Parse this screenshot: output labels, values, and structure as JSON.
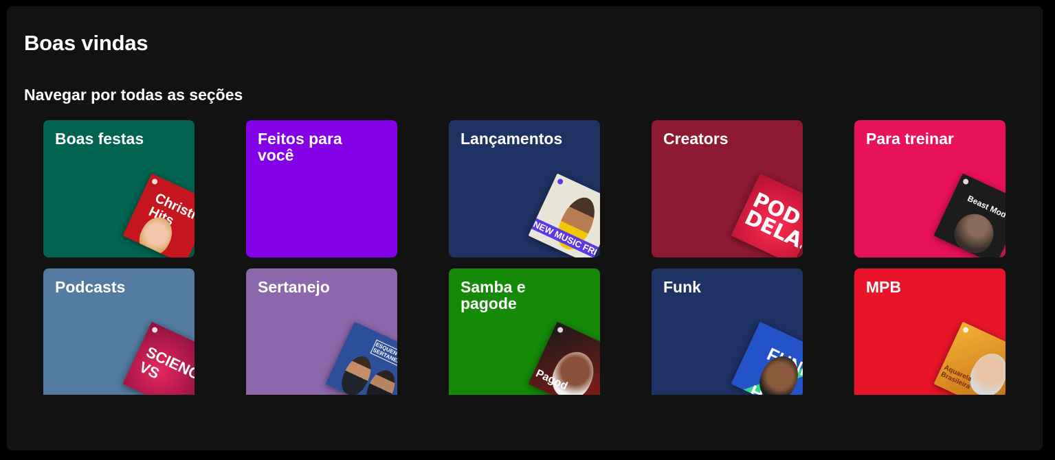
{
  "page": {
    "title": "Boas vindas",
    "section_title": "Navegar por todas as seções"
  },
  "cards": [
    {
      "label": "Boas festas",
      "color": "#006450",
      "cover": {
        "name": "christmas-hits-cover",
        "text": "Christmas Hits",
        "bg": "#c4161c"
      }
    },
    {
      "label": "Feitos para você",
      "color": "#8400e7",
      "cover": null
    },
    {
      "label": "Lançamentos",
      "color": "#1e3264",
      "cover": {
        "name": "new-music-friday-cover",
        "text": "NEW MUSIC FRIDAY",
        "bg": "#e9e4d8"
      }
    },
    {
      "label": "Creators",
      "color": "#8d1932",
      "cover": {
        "name": "pod-delas-cover",
        "text": "POD DELAS",
        "bg": "#d0163a"
      }
    },
    {
      "label": "Para treinar",
      "color": "#e8115b",
      "cover": {
        "name": "beast-mode-cover",
        "text": "Beast Mode",
        "bg": "#1c1c1c"
      }
    },
    {
      "label": "Podcasts",
      "color": "#537aa1",
      "cover": {
        "name": "science-vs-cover",
        "text": "SCIENCE VS",
        "bg": "#c0114b"
      }
    },
    {
      "label": "Sertanejo",
      "color": "#8d67ab",
      "cover": {
        "name": "esquenta-sertanejo-cover",
        "text": "ESQUENTA SERTANEJO",
        "bg": "#2c4f9a"
      }
    },
    {
      "label": "Samba e pagode",
      "color": "#148a08",
      "cover": {
        "name": "pagodeira-cover",
        "text": "Pagod",
        "bg": "#8e1c16"
      }
    },
    {
      "label": "Funk",
      "color": "#1e3264",
      "cover": {
        "name": "funk-hits-cover",
        "text": "FUNK HITS",
        "bg": "#2452c9"
      }
    },
    {
      "label": "MPB",
      "color": "#e91429",
      "cover": {
        "name": "aquarela-brasileira-cover",
        "text": "Aquarela Brasileira",
        "bg": "#d88a1c"
      }
    }
  ]
}
